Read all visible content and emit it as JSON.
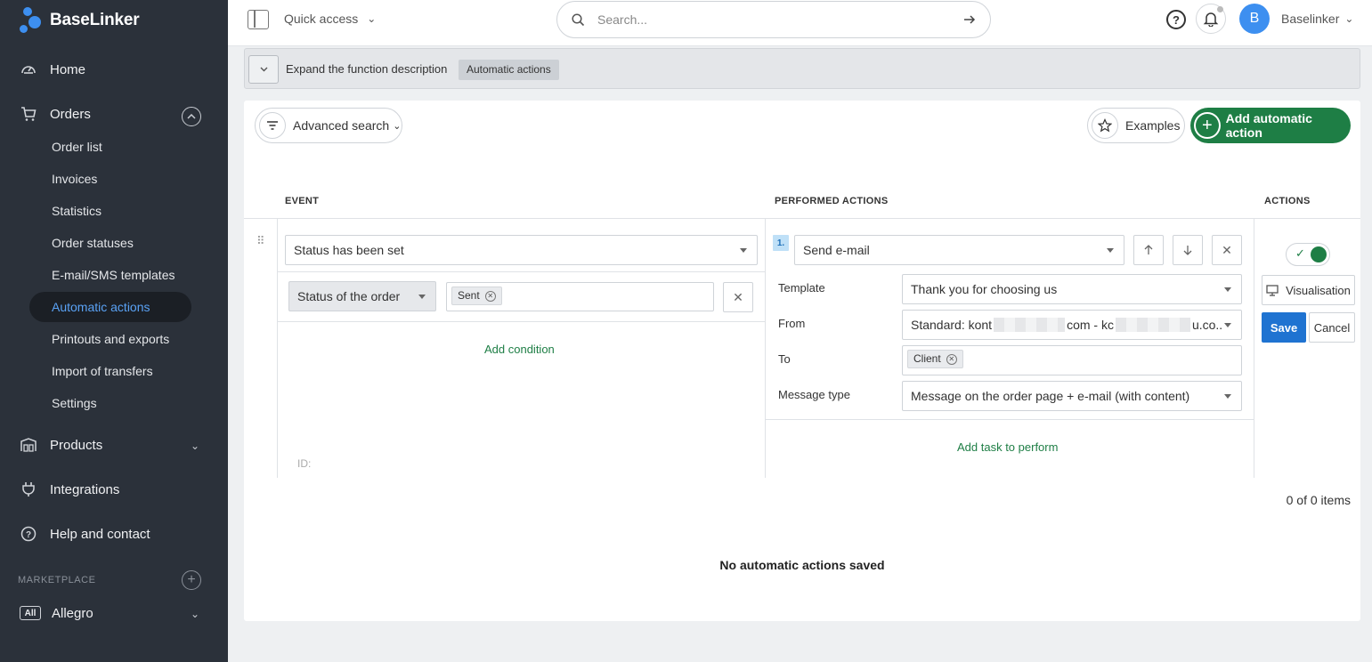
{
  "brand": {
    "name": "BaseLinker"
  },
  "sidebar": {
    "home": "Home",
    "orders": "Orders",
    "orders_sub": [
      "Order list",
      "Invoices",
      "Statistics",
      "Order statuses",
      "E-mail/SMS templates",
      "Automatic actions",
      "Printouts and exports",
      "Import of transfers",
      "Settings"
    ],
    "products": "Products",
    "integrations": "Integrations",
    "help": "Help and contact",
    "marketplace_label": "MARKETPLACE",
    "allegro_badge": "All",
    "allegro": "Allegro"
  },
  "topbar": {
    "quick_access": "Quick access",
    "search_placeholder": "Search...",
    "avatar_letter": "B",
    "user": "Baselinker"
  },
  "description_bar": {
    "text": "Expand the function description",
    "tag": "Automatic actions"
  },
  "toolbar": {
    "advanced_search": "Advanced search",
    "examples": "Examples",
    "add_action": "Add automatic action"
  },
  "table": {
    "headers": {
      "event": "EVENT",
      "performed": "PERFORMED ACTIONS",
      "actions": "ACTIONS"
    },
    "event": {
      "trigger": "Status has been set",
      "condition_field": "Status of the order",
      "condition_value": "Sent",
      "add_condition": "Add condition",
      "id_label": "ID:"
    },
    "performed": {
      "step": "1.",
      "action": "Send e-mail",
      "template_label": "Template",
      "template_value": "Thank you for choosing us",
      "from_label": "From",
      "from_prefix": "Standard: kont",
      "from_mid": "com - kc",
      "from_suffix": "u.co..",
      "to_label": "To",
      "to_value": "Client",
      "message_type_label": "Message type",
      "message_type_value": "Message on the order page + e-mail (with content)",
      "add_task": "Add task to perform"
    },
    "row_actions": {
      "visualisation": "Visualisation",
      "save": "Save",
      "cancel": "Cancel"
    }
  },
  "footer": {
    "items_count": "0 of 0 items",
    "empty": "No automatic actions saved"
  }
}
